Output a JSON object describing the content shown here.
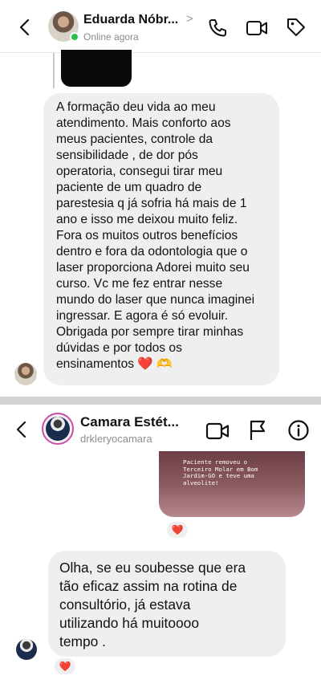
{
  "chat1": {
    "contact_name": "Eduarda Nóbr...",
    "status": "Online agora",
    "name_chevron": ">",
    "icons": {
      "back": "chevron-left-icon",
      "call": "phone-icon",
      "video": "video-camera-icon",
      "label": "tag-icon"
    },
    "message": "A formação deu vida ao meu\natendimento.  Mais conforto aos\nmeus pacientes, controle da\nsensibilidade , de dor pós\noperatoria, consegui tirar meu\npaciente de um quadro de\nparestesia q já sofria há mais de 1\nano e isso me deixou muito feliz.\nFora os muitos outros benefícios\ndentro e fora da odontologia que o\nlaser proporciona  Adorei muito seu\ncurso. Vc me fez entrar nesse\nmundo do laser que nunca imaginei\ningressar. E agora é só evoluir.\nObrigada por sempre tirar minhas\ndúvidas e por todos os\nensinamentos ❤️ 🫶"
  },
  "chat2": {
    "contact_name": "Camara Estét...",
    "handle": "drkleryocamara",
    "icons": {
      "back": "chevron-left-icon",
      "video": "video-camera-icon",
      "report": "flag-icon",
      "info": "info-icon"
    },
    "media_caption": "Paciente removeu o\nTerceiro Molar em Bom\nJardim-GO e teve uma\nalveolite!",
    "media_reaction": "❤️",
    "message": "Olha, se eu soubesse que era\ntão eficaz assim na rotina de\nconsultório, já estava\nutilizando há muitoooo\ntempo .",
    "message_reaction": "❤️"
  },
  "colors": {
    "bubble": "#efefef",
    "online": "#2dbf4e",
    "story_ring": "#c74fa5",
    "divider": "#d3d3d3"
  }
}
